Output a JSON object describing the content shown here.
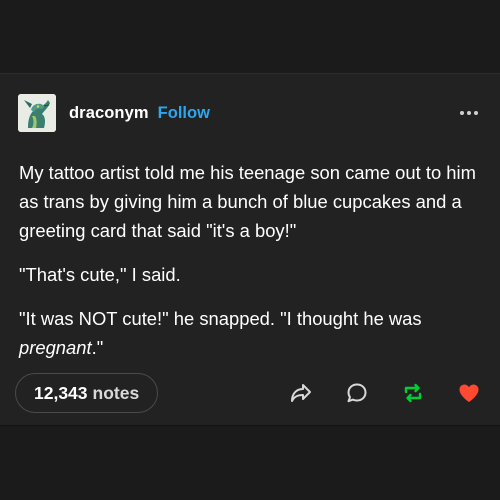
{
  "post": {
    "blog_name": "draconym",
    "follow_label": "Follow",
    "body": {
      "paragraph_1": "My tattoo artist told me his teenage son came out to him as trans by giving him a bunch of blue cupcakes and a greeting card that said \"it's a boy!\"",
      "paragraph_2": "\"That's cute,\" I said.",
      "paragraph_3_start": "\"It was NOT cute!\" he snapped. \"I thought he was ",
      "paragraph_3_italic": "pregnant",
      "paragraph_3_end": ".\""
    },
    "notes": {
      "count": "12,343",
      "label": "notes"
    }
  },
  "icons": {
    "avatar": "dragon-avatar",
    "more": "ellipsis-icon",
    "share": "share-arrow-icon",
    "reply": "reply-bubble-icon",
    "reblog": "reblog-icon",
    "like": "heart-icon"
  },
  "colors": {
    "accent": "#2aa7f0",
    "reblog": "#00cf35",
    "like": "#ff4930"
  }
}
